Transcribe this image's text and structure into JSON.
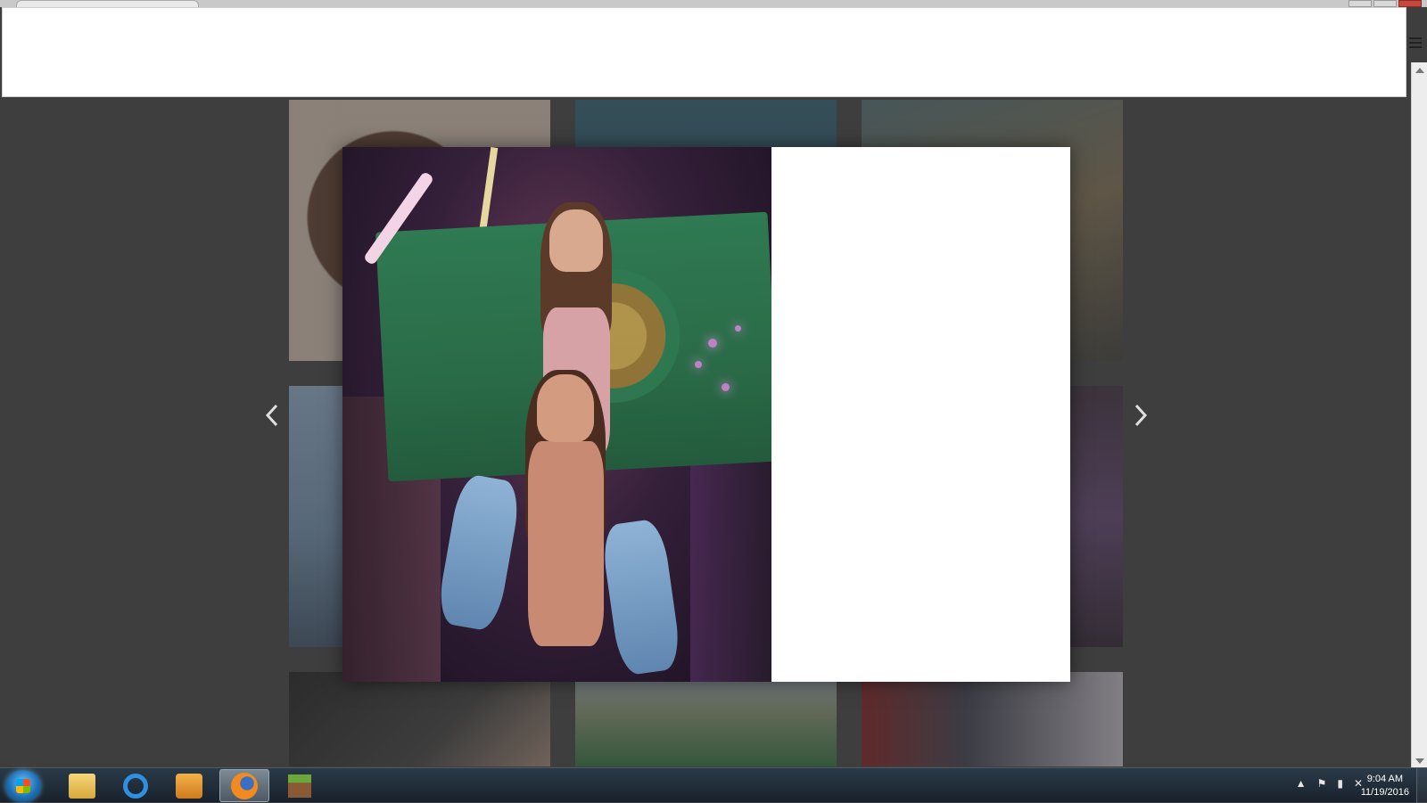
{
  "window": {
    "menu_icon": "hamburger-menu-icon"
  },
  "lightbox": {
    "prev_icon": "chevron-left-icon",
    "next_icon": "chevron-right-icon"
  },
  "taskbar": {
    "start_icon": "windows-start-icon",
    "apps": [
      {
        "name": "file-explorer-icon",
        "active": false
      },
      {
        "name": "internet-explorer-icon",
        "active": false
      },
      {
        "name": "media-player-icon",
        "active": false
      },
      {
        "name": "firefox-icon",
        "active": true
      },
      {
        "name": "minecraft-icon",
        "active": false
      }
    ],
    "tray_icons": [
      "show-hidden-icons-arrow",
      "action-center-flag-icon",
      "network-signal-icon",
      "volume-muted-icon"
    ],
    "clock": {
      "time": "9:04 AM",
      "date": "11/19/2016"
    }
  }
}
